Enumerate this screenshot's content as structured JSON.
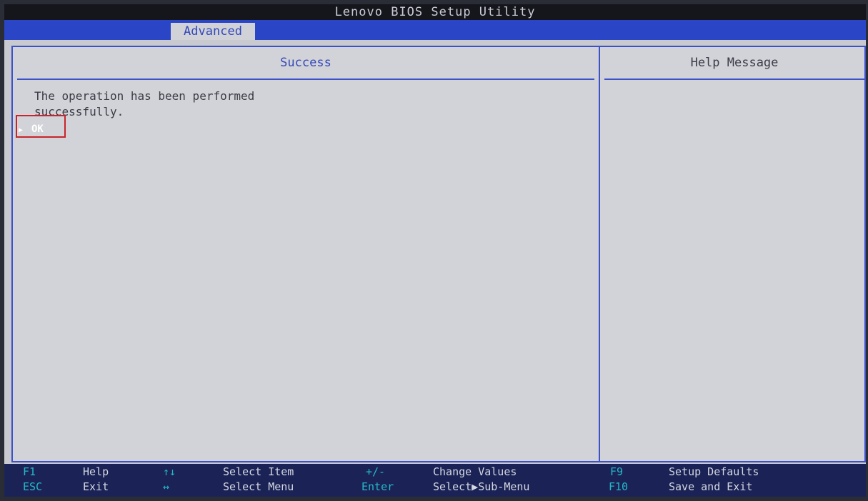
{
  "window": {
    "title": "Lenovo BIOS Setup Utility"
  },
  "tabs": [
    {
      "label": "Advanced",
      "active": true
    }
  ],
  "main": {
    "title": "Success",
    "message_line1": "The operation has been performed",
    "message_line2": "successfully.",
    "ok_label": "OK",
    "ok_arrow": "▶"
  },
  "help": {
    "title": "Help Message"
  },
  "footer": {
    "f1_key": "F1",
    "f1_desc": "Help",
    "esc_key": "ESC",
    "esc_desc": "Exit",
    "updown_key": "↑↓",
    "updown_desc": "Select Item",
    "leftright_key": "↔",
    "leftright_desc": "Select Menu",
    "plusminus_key": "+/-",
    "plusminus_desc": "Change Values",
    "enter_key": "Enter",
    "enter_desc": "Select▶Sub-Menu",
    "f9_key": "F9",
    "f9_desc": "Setup Defaults",
    "f10_key": "F10",
    "f10_desc": "Save and Exit"
  },
  "colors": {
    "background": "#c9cacf",
    "accent_blue": "#2b45c7",
    "footer_bg": "#1b2356",
    "key_cyan": "#24b8c8",
    "highlight_red": "#c8242a"
  }
}
